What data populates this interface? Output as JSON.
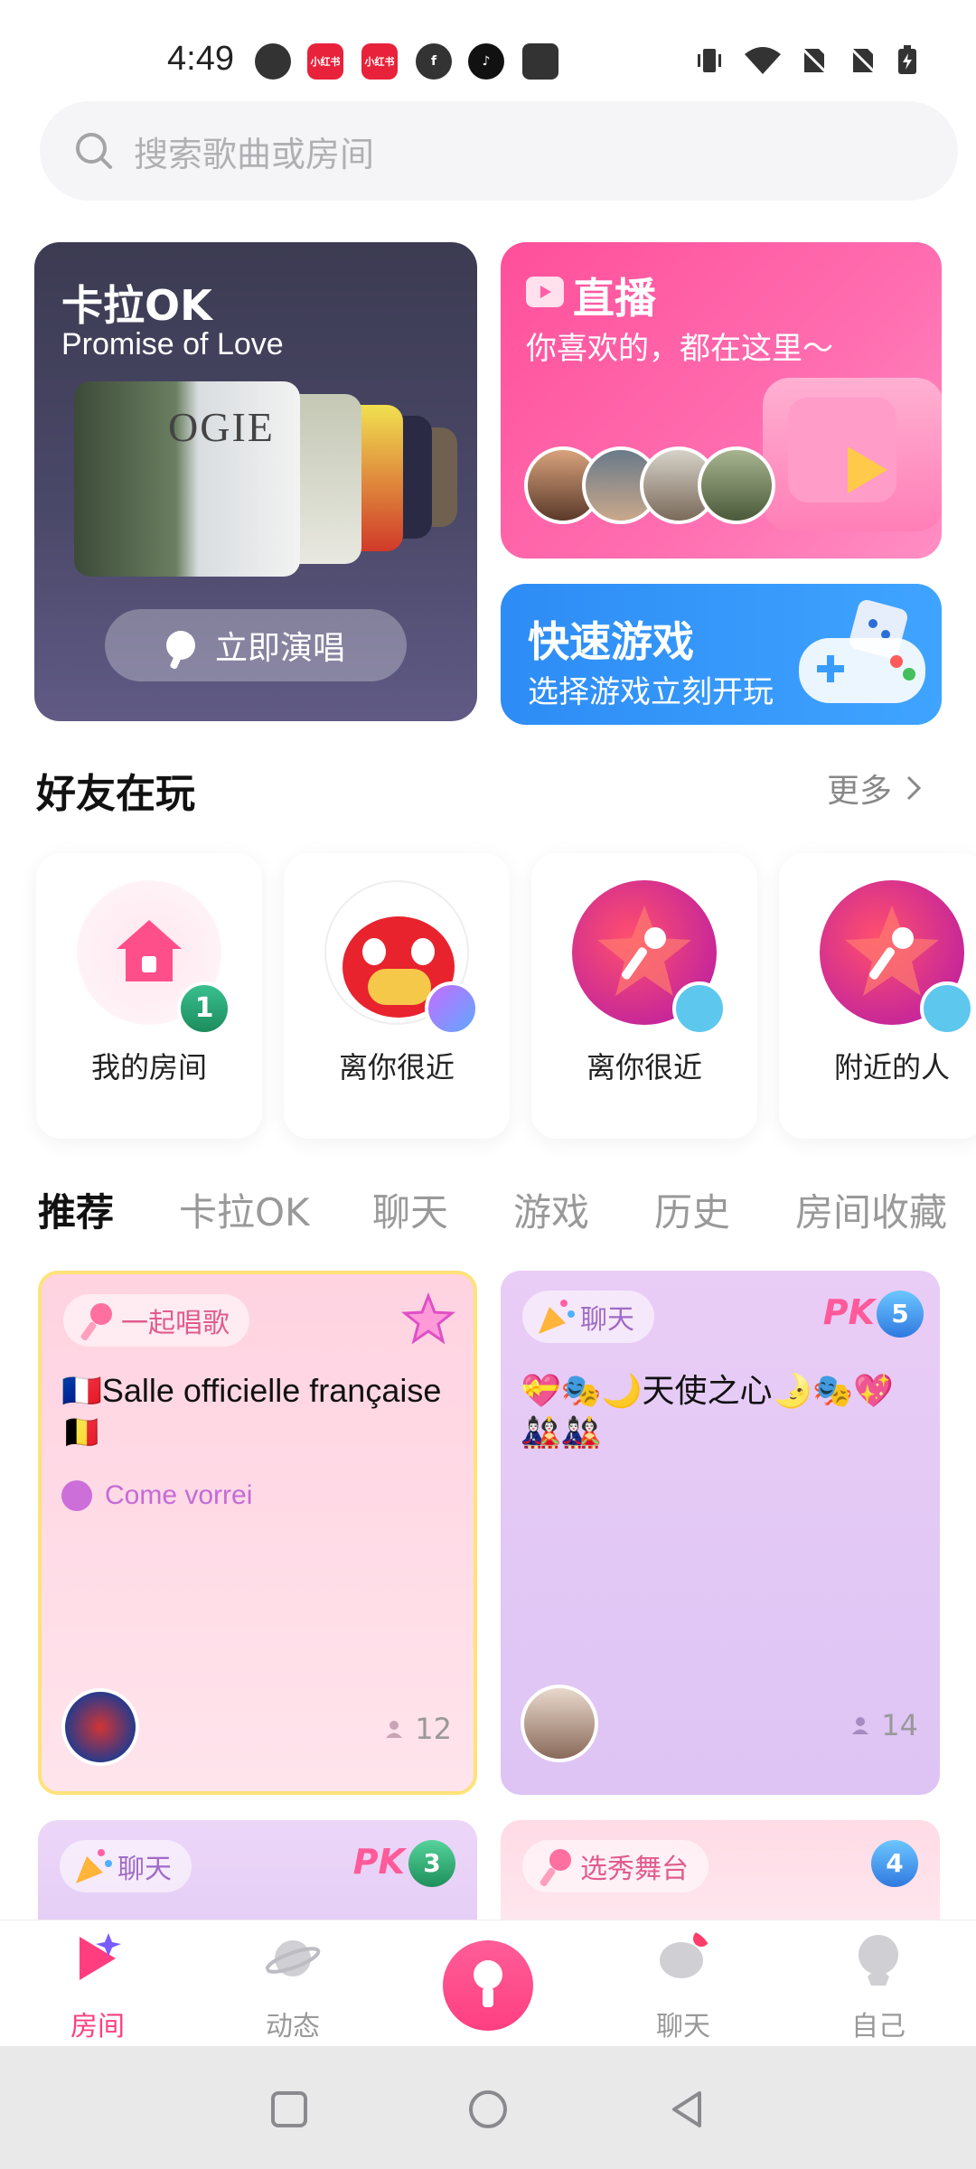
{
  "status_bar": {
    "time": "4:49",
    "icons_left": [
      "app-icon",
      "xiaohongshu-icon",
      "xiaohongshu-icon",
      "facebook-icon",
      "tiktok-icon",
      "app-icon"
    ],
    "icons_right": [
      "vibrate-icon",
      "wifi-icon",
      "no-sim-icon",
      "no-sim-icon",
      "battery-charging-icon"
    ]
  },
  "search": {
    "placeholder": "搜索歌曲或房间"
  },
  "karaoke_card": {
    "title": "卡拉OK",
    "song": "Promise of Love",
    "button_label": "立即演唱"
  },
  "live_card": {
    "title": "直播",
    "subtitle": "你喜欢的，都在这里～"
  },
  "game_card": {
    "title": "快速游戏",
    "subtitle": "选择游戏立刻开玩"
  },
  "friends_section": {
    "title": "好友在玩",
    "more_label": "更多",
    "items": [
      {
        "label": "我的房间",
        "badge": "1"
      },
      {
        "label": "离你很近"
      },
      {
        "label": "离你很近"
      },
      {
        "label": "附近的人"
      }
    ]
  },
  "tabs": [
    {
      "label": "推荐",
      "active": true
    },
    {
      "label": "卡拉OK",
      "active": false
    },
    {
      "label": "聊天",
      "active": false
    },
    {
      "label": "游戏",
      "active": false
    },
    {
      "label": "历史",
      "active": false
    },
    {
      "label": "房间收藏",
      "active": false
    }
  ],
  "rooms": [
    {
      "tag": "一起唱歌",
      "title": "🇫🇷Salle officielle française🇧🇪",
      "song": "Come vorrei",
      "count": "12"
    },
    {
      "tag": "聊天",
      "title": "💝🎭🌙天使之心🌛🎭💖🎎🎎",
      "pk_level": "5",
      "count": "14"
    },
    {
      "tag": "聊天",
      "pk_level": "3"
    },
    {
      "tag": "选秀舞台",
      "level": "4"
    }
  ],
  "bottom_nav": [
    {
      "label": "房间",
      "active": true
    },
    {
      "label": "动态",
      "active": false
    },
    {
      "label": "聊天",
      "active": false
    },
    {
      "label": "自己",
      "active": false
    }
  ],
  "colors": {
    "accent": "#ff3d7f",
    "live_pink": "#ff5fa6",
    "game_blue": "#3a9cff",
    "karaoke_bg": "#46455f"
  }
}
